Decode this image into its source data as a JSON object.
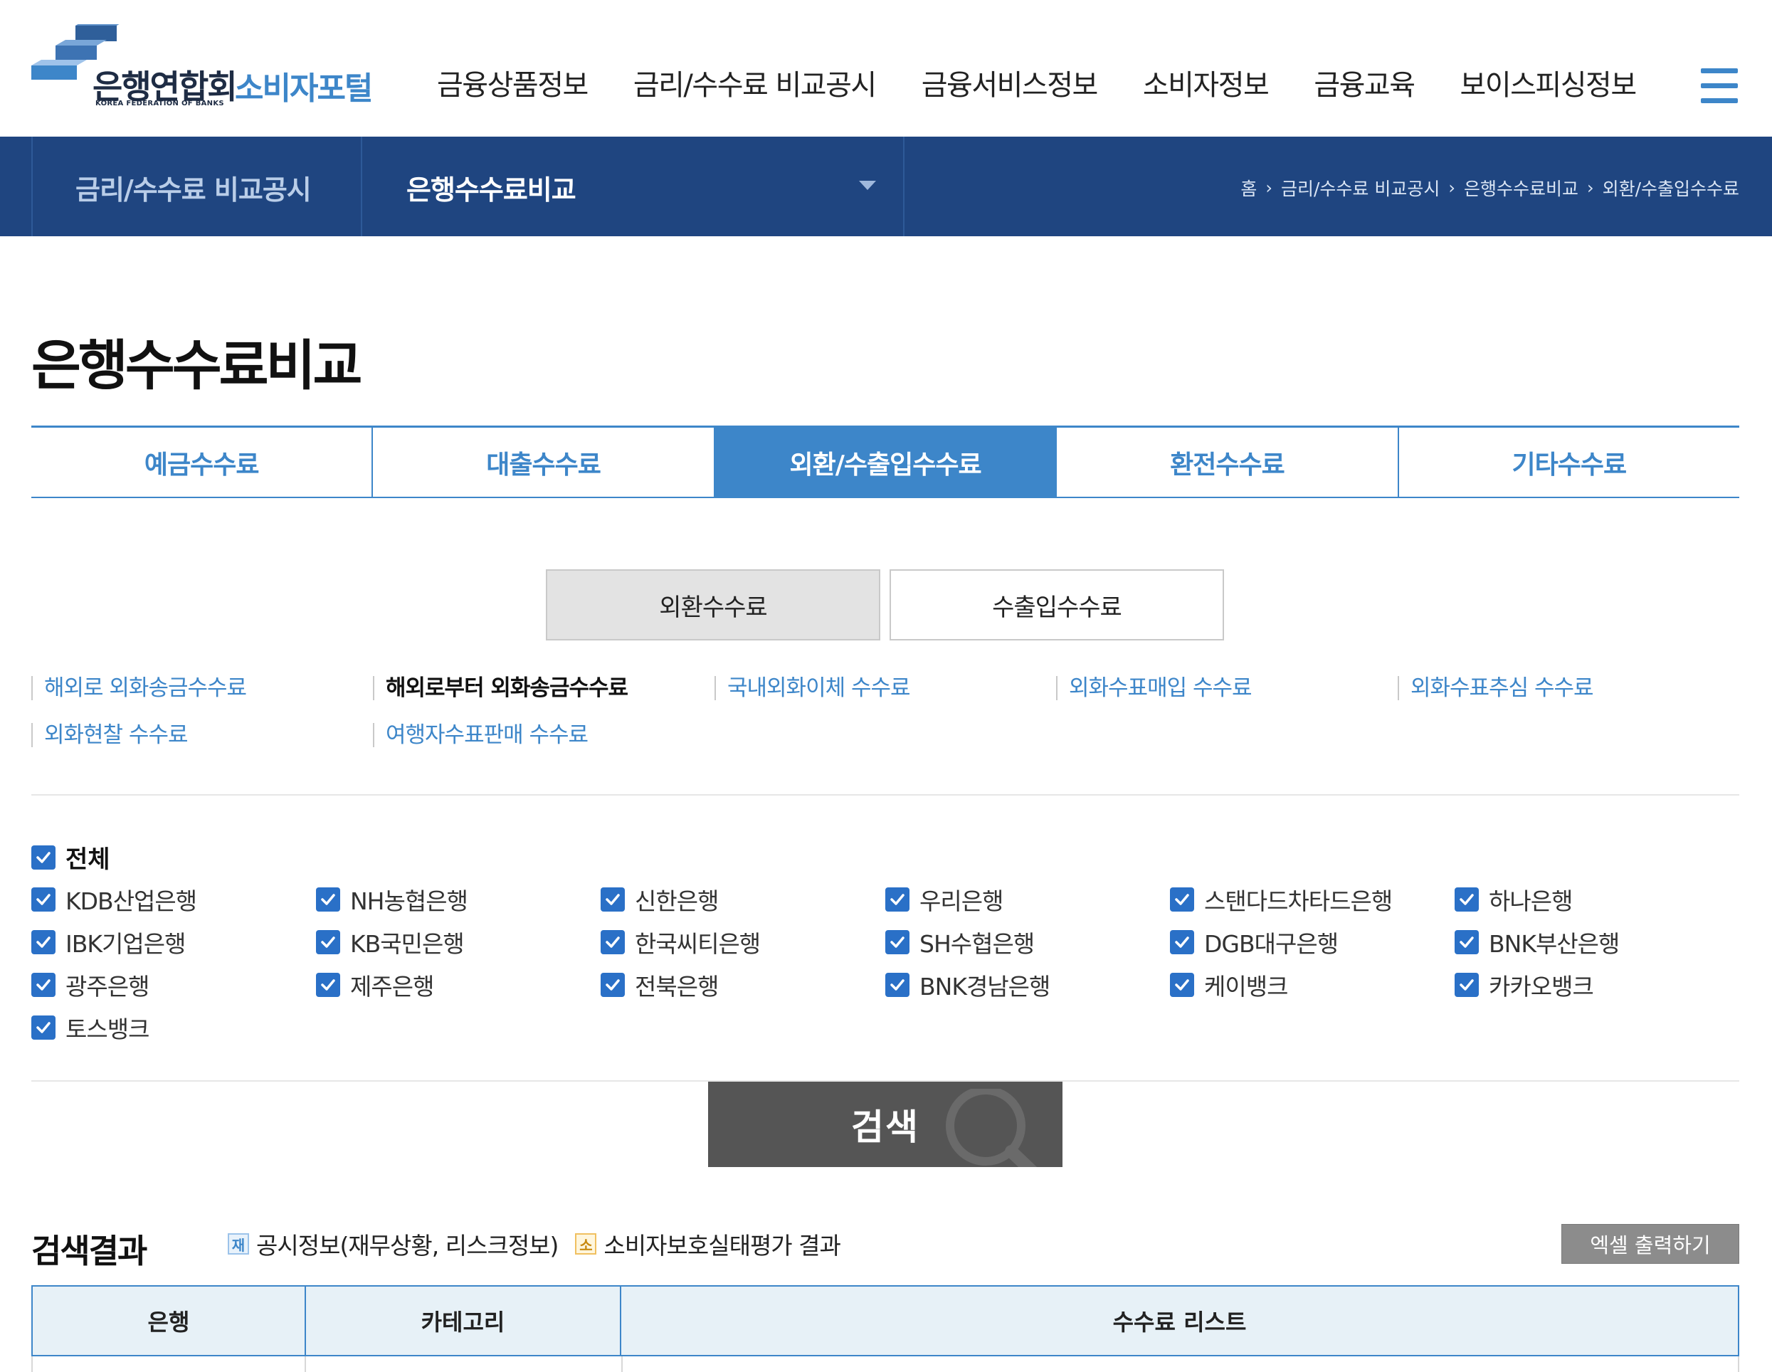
{
  "header": {
    "logo_korean": "은행연합회",
    "logo_english": "KOREA FEDERATION OF BANKS",
    "portal_name": "소비자포털",
    "menu_icon": "hamburger-menu-icon",
    "gnb": [
      "금융상품정보",
      "금리/수수료 비교공시",
      "금융서비스정보",
      "소비자정보",
      "금융교육",
      "보이스피싱정보"
    ]
  },
  "subnav": {
    "category": "금리/수수료 비교공시",
    "current": "은행수수료비교",
    "breadcrumb": [
      "홈",
      "금리/수수료 비교공시",
      "은행수수료비교",
      "외환/수출입수수료"
    ]
  },
  "page_title": "은행수수료비교",
  "tabs": [
    {
      "label": "예금수수료",
      "active": false
    },
    {
      "label": "대출수수료",
      "active": false
    },
    {
      "label": "외환/수출입수수료",
      "active": true
    },
    {
      "label": "환전수수료",
      "active": false
    },
    {
      "label": "기타수수료",
      "active": false
    }
  ],
  "subtabs": [
    {
      "label": "외환수수료",
      "active": true
    },
    {
      "label": "수출입수수료",
      "active": false
    }
  ],
  "fee_links": [
    [
      {
        "label": "해외로 외화송금수수료",
        "active": false
      },
      {
        "label": "해외로부터 외화송금수수료",
        "active": true
      },
      {
        "label": "국내외화이체 수수료",
        "active": false
      },
      {
        "label": "외화수표매입 수수료",
        "active": false
      },
      {
        "label": "외화수표추심 수수료",
        "active": false
      }
    ],
    [
      {
        "label": "외화현찰 수수료",
        "active": false
      },
      {
        "label": "여행자수표판매 수수료",
        "active": false
      }
    ]
  ],
  "banks": {
    "all_label": "전체",
    "all_checked": true,
    "list": [
      {
        "name": "KDB산업은행",
        "checked": true
      },
      {
        "name": "NH농협은행",
        "checked": true
      },
      {
        "name": "신한은행",
        "checked": true
      },
      {
        "name": "우리은행",
        "checked": true
      },
      {
        "name": "스탠다드차타드은행",
        "checked": true
      },
      {
        "name": "하나은행",
        "checked": true
      },
      {
        "name": "IBK기업은행",
        "checked": true
      },
      {
        "name": "KB국민은행",
        "checked": true
      },
      {
        "name": "한국씨티은행",
        "checked": true
      },
      {
        "name": "SH수협은행",
        "checked": true
      },
      {
        "name": "DGB대구은행",
        "checked": true
      },
      {
        "name": "BNK부산은행",
        "checked": true
      },
      {
        "name": "광주은행",
        "checked": true
      },
      {
        "name": "제주은행",
        "checked": true
      },
      {
        "name": "전북은행",
        "checked": true
      },
      {
        "name": "BNK경남은행",
        "checked": true
      },
      {
        "name": "케이뱅크",
        "checked": true
      },
      {
        "name": "카카오뱅크",
        "checked": true
      },
      {
        "name": "토스뱅크",
        "checked": true
      }
    ]
  },
  "search_button": "검색",
  "results": {
    "title": "검색결과",
    "legend": [
      {
        "badge": "재",
        "text": "공시정보(재무상황, 리스크정보)",
        "color": "blue"
      },
      {
        "badge": "소",
        "text": "소비자보호실태평가 결과",
        "color": "orange"
      }
    ],
    "excel_button": "엑셀 출력하기",
    "columns": [
      "은행",
      "카테고리",
      "수수료 리스트"
    ]
  },
  "colors": {
    "primary": "#3d86c9",
    "navy": "#1f4580",
    "checkbox": "#2a70c7",
    "search_button": "#555555"
  }
}
